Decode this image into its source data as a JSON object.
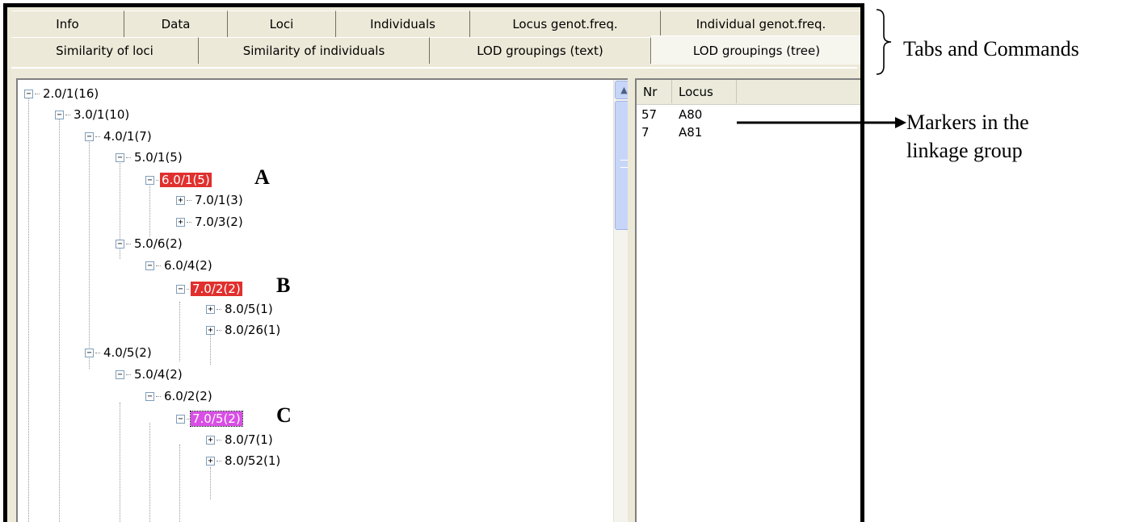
{
  "tabs_row1": [
    {
      "label": "Info"
    },
    {
      "label": "Data"
    },
    {
      "label": "Loci"
    },
    {
      "label": "Individuals"
    },
    {
      "label": "Locus genot.freq."
    },
    {
      "label": "Individual genot.freq."
    }
  ],
  "tabs_row2": [
    {
      "label": "Similarity of loci"
    },
    {
      "label": "Similarity of individuals"
    },
    {
      "label": "LOD groupings (text)"
    },
    {
      "label": "LOD groupings (tree)",
      "active": true
    }
  ],
  "tree": {
    "nodes": [
      {
        "label": "2.0/1(16)",
        "expander": "−"
      },
      {
        "label": "3.0/1(10)",
        "expander": "−"
      },
      {
        "label": "4.0/1(7)",
        "expander": "−"
      },
      {
        "label": "5.0/1(5)",
        "expander": "−"
      },
      {
        "label": "6.0/1(5)",
        "expander": "−",
        "highlight": "red",
        "tag": "A"
      },
      {
        "label": "7.0/1(3)",
        "expander": "+"
      },
      {
        "label": "7.0/3(2)",
        "expander": "+"
      },
      {
        "label": "5.0/6(2)",
        "expander": "−"
      },
      {
        "label": "6.0/4(2)",
        "expander": "−"
      },
      {
        "label": "7.0/2(2)",
        "expander": "−",
        "highlight": "red",
        "tag": "B"
      },
      {
        "label": "8.0/5(1)",
        "expander": "+"
      },
      {
        "label": "8.0/26(1)",
        "expander": "+"
      },
      {
        "label": "4.0/5(2)",
        "expander": "−"
      },
      {
        "label": "5.0/4(2)",
        "expander": "−"
      },
      {
        "label": "6.0/2(2)",
        "expander": "−"
      },
      {
        "label": "7.0/5(2)",
        "expander": "−",
        "highlight": "magenta",
        "tag": "C"
      },
      {
        "label": "8.0/7(1)",
        "expander": "+"
      },
      {
        "label": "8.0/52(1)",
        "expander": "+"
      }
    ]
  },
  "list": {
    "columns": [
      "Nr",
      "Locus"
    ],
    "rows": [
      {
        "nr": "57",
        "locus": "A80"
      },
      {
        "nr": "7",
        "locus": "A81"
      }
    ]
  },
  "annotations": {
    "tabs_and_commands": "Tabs and Commands",
    "markers_line1": "Markers in the",
    "markers_line2": "linkage group"
  },
  "colors": {
    "highlight_red": "#e0302e",
    "highlight_magenta": "#d94ee6"
  }
}
